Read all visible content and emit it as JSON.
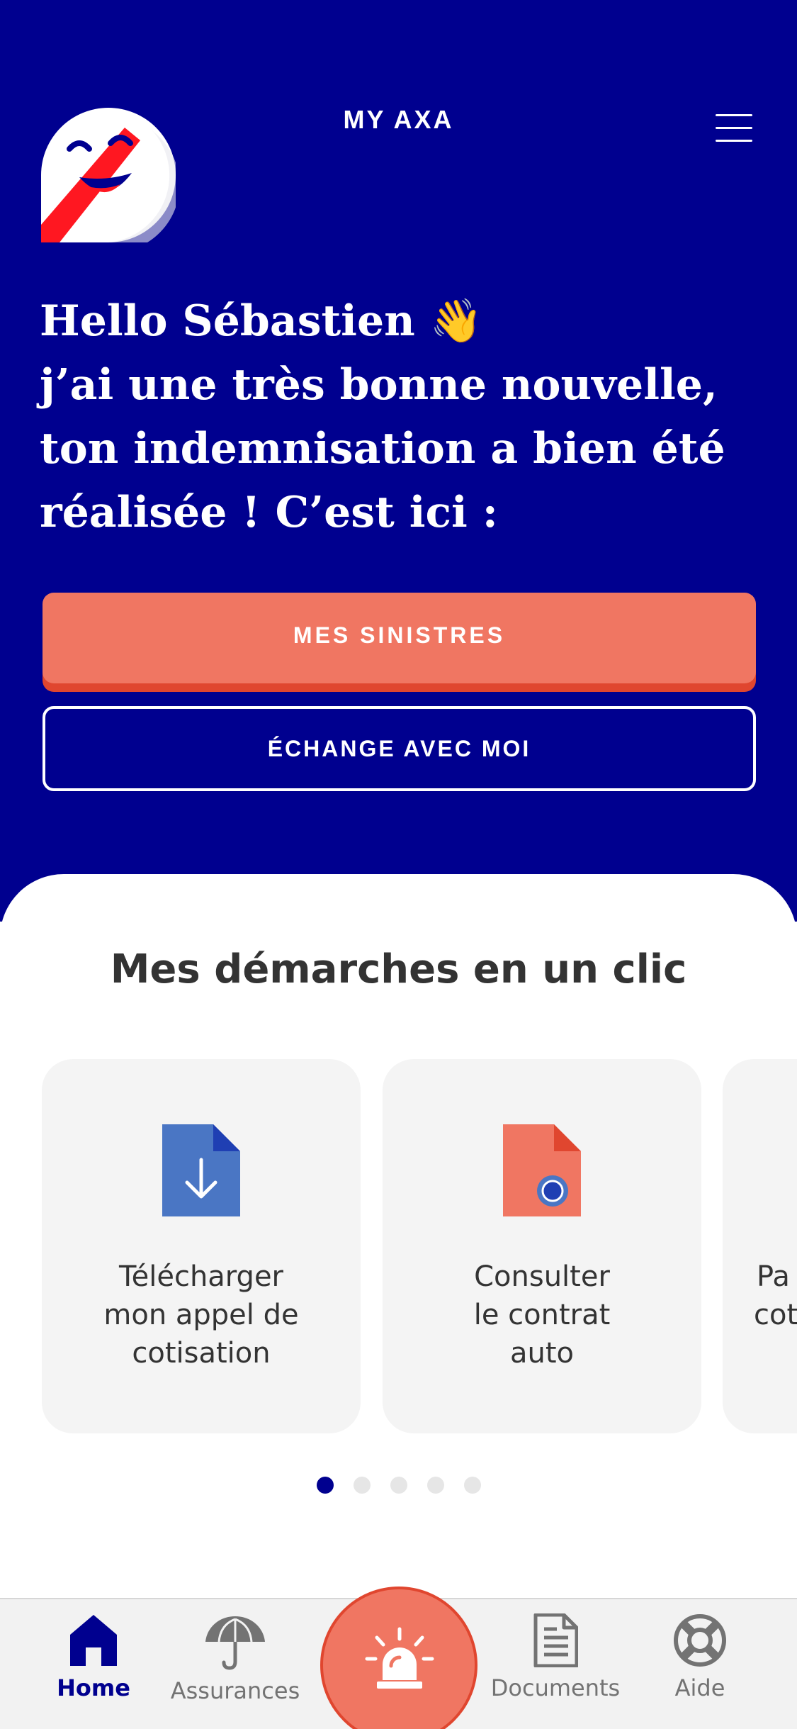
{
  "header": {
    "app_title": "MY AXA",
    "logo_icon": "axa-mascot-icon",
    "menu_icon": "hamburger-menu-icon"
  },
  "hero": {
    "greeting_lines": [
      "Hello Sébastien 👋",
      "j’ai une très bonne nouvelle,",
      "ton indemnisation a bien été",
      "réalisée ! C’est ici :"
    ],
    "primary_button": "MES SINISTRES",
    "secondary_button": "ÉCHANGE AVEC MOI"
  },
  "quick_actions": {
    "title": "Mes démarches en un clic",
    "cards": [
      {
        "icon": "download-document-icon",
        "label_lines": [
          "Télécharger",
          "mon appel de",
          "cotisation"
        ]
      },
      {
        "icon": "contract-document-icon",
        "label_lines": [
          "Consulter",
          "le contrat",
          "auto"
        ]
      },
      {
        "label_lines": [
          "Pa",
          "cot"
        ]
      }
    ],
    "pagination": {
      "total": 5,
      "active": 1
    }
  },
  "tabbar": {
    "tabs": [
      {
        "label": "Home",
        "icon": "home-icon",
        "active": true
      },
      {
        "label": "Assurances",
        "icon": "umbrella-icon",
        "active": false
      },
      {
        "label": "Documents",
        "icon": "document-icon",
        "active": false
      },
      {
        "label": "Aide",
        "icon": "lifebuoy-icon",
        "active": false
      }
    ],
    "center_action_icon": "emergency-siren-icon"
  },
  "colors": {
    "brand_blue": "#00008f",
    "accent_coral": "#f07662",
    "accent_red": "#e0462f",
    "card_bg": "#f4f4f4"
  }
}
